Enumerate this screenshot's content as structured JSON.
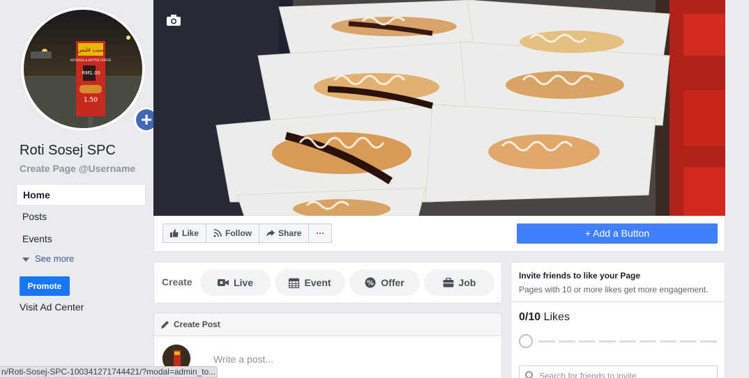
{
  "sidebar": {
    "page_name": "Roti Sosej SPC",
    "username": "Create Page @Username",
    "nav": [
      "Home",
      "Posts",
      "Events"
    ],
    "see_more": "See more",
    "promote": "Promote",
    "visit_ad_center": "Visit Ad Center",
    "profile_banner_text": "سيب قلبس",
    "profile_banner_sub": "HOTDOGS & BUTTER COFFEE",
    "profile_price_1": "RM1.00",
    "profile_price_2": "1.50"
  },
  "action_bar": {
    "like": "Like",
    "follow": "Follow",
    "share": "Share",
    "more": "···",
    "add_button": "Add a Button"
  },
  "create": {
    "label": "Create",
    "live": "Live",
    "event": "Event",
    "offer": "Offer",
    "job": "Job"
  },
  "create_post": {
    "title": "Create Post",
    "placeholder": "Write a post..."
  },
  "invite": {
    "title": "Invite friends to like your Page",
    "subtitle": "Pages with 10 or more likes get more engagement.",
    "count": "0/10",
    "likes_label": "Likes",
    "progress": 0,
    "search_placeholder": "Search for friends to invite"
  },
  "status_url": "n/Roti-Sosej-SPC-100341271744421/?modal=admin_to...",
  "colors": {
    "accent": "#4267b2",
    "add_button": "#4080ff",
    "promote": "#1877f2"
  }
}
